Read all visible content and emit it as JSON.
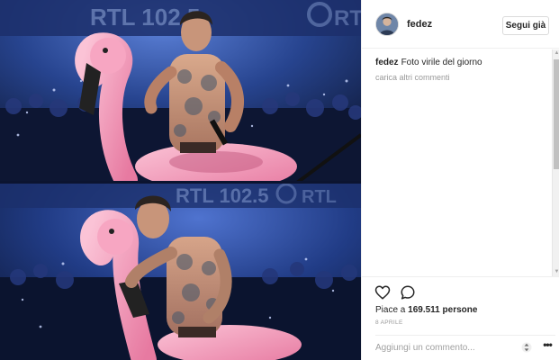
{
  "photo": {
    "alt": "Foto virile del giorno",
    "banner_text": "RTL 102.5",
    "banner_mark": "RTL"
  },
  "post": {
    "username": "fedez",
    "follow_label": "Segui già",
    "caption_user": "fedez",
    "caption_text": "Foto virile del giorno",
    "load_more_label": "carica altri commenti",
    "likes_prefix": "Piace a",
    "likes_count": "169.511",
    "likes_suffix": "persone",
    "date": "8 APRILE",
    "comment_placeholder": "Aggiungi un commento..."
  },
  "icons": {
    "like": "heart-icon",
    "comment": "speech-bubble-icon",
    "sort": "up-down-arrows-icon",
    "more": "ellipsis-icon"
  },
  "colors": {
    "text": "#262626",
    "muted": "#999999",
    "border": "#efefef",
    "stage_blue": "#1f3a86",
    "flamingo_pink": "#f48fb1"
  }
}
